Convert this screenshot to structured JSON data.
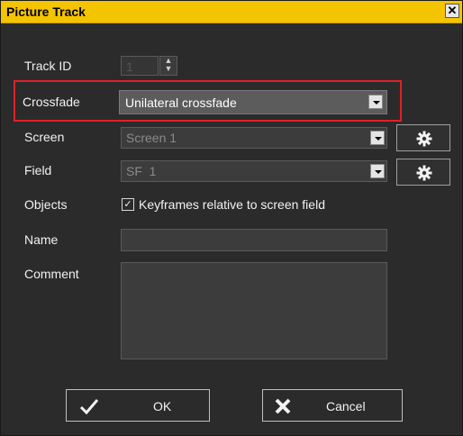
{
  "window": {
    "title": "Picture Track",
    "close_glyph": "✕"
  },
  "track_id": {
    "label": "Track ID",
    "value": "1"
  },
  "crossfade": {
    "label": "Crossfade",
    "value": "Unilateral crossfade"
  },
  "screen": {
    "label": "Screen",
    "value": "Screen 1"
  },
  "field": {
    "label": "Field",
    "value": "SF  1"
  },
  "objects": {
    "label": "Objects",
    "checkbox_label": "Keyframes relative to screen field",
    "checked": true
  },
  "name": {
    "label": "Name",
    "value": ""
  },
  "comment": {
    "label": "Comment",
    "value": ""
  },
  "buttons": {
    "ok_label": "OK",
    "cancel_label": "Cancel"
  },
  "colors": {
    "title_bar": "#f5c400",
    "dialog_bg": "#2b2b2b",
    "highlight": "#e0202a"
  }
}
